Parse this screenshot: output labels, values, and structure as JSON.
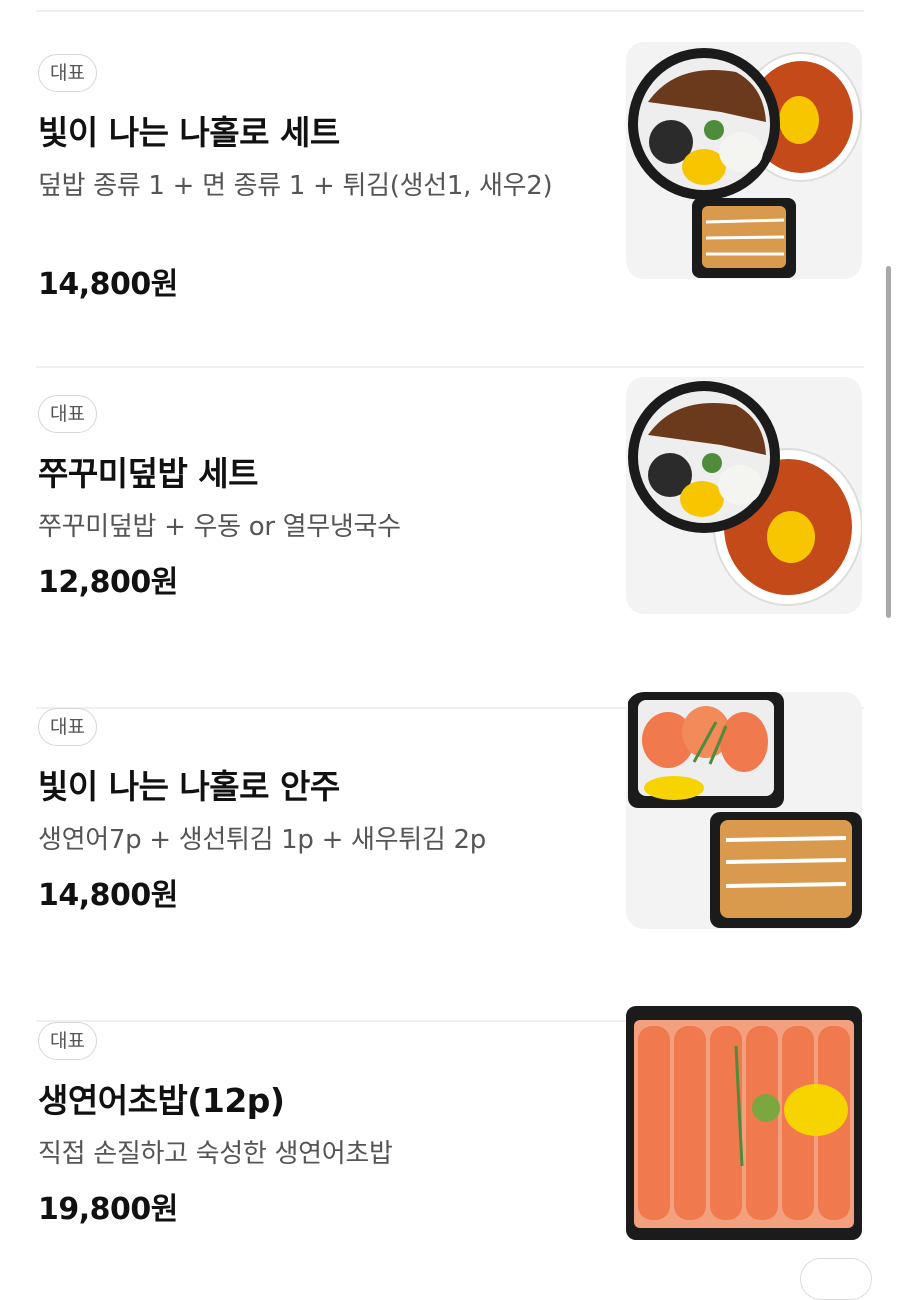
{
  "menu": {
    "items": [
      {
        "badge": "대표",
        "name": "빛이 나는 나홀로 세트",
        "description": "덮밥 종류 1 + 면 종류 1 + 튀김(생선1, 새우2)",
        "price": "14,800원",
        "image": "donburi-noodle-tempura-set"
      },
      {
        "badge": "대표",
        "name": "쭈꾸미덮밥 세트",
        "description": "쭈꾸미덮밥 + 우동 or 열무냉국수",
        "price": "12,800원",
        "image": "donburi-noodle-set"
      },
      {
        "badge": "대표",
        "name": "빛이 나는 나홀로 안주",
        "description": "생연어7p + 생선튀김 1p + 새우튀김 2p",
        "price": "14,800원",
        "image": "salmon-and-tempura-boxes"
      },
      {
        "badge": "대표",
        "name": "생연어초밥(12p)",
        "description": "직접 손질하고 숙성한 생연어초밥",
        "price": "19,800원",
        "image": "salmon-sushi-box"
      }
    ]
  },
  "colors": {
    "salmon": "#f07a4d",
    "rice_topping": "#f7c600",
    "broth": "#c44a1a",
    "container": "#1b1b1b"
  }
}
